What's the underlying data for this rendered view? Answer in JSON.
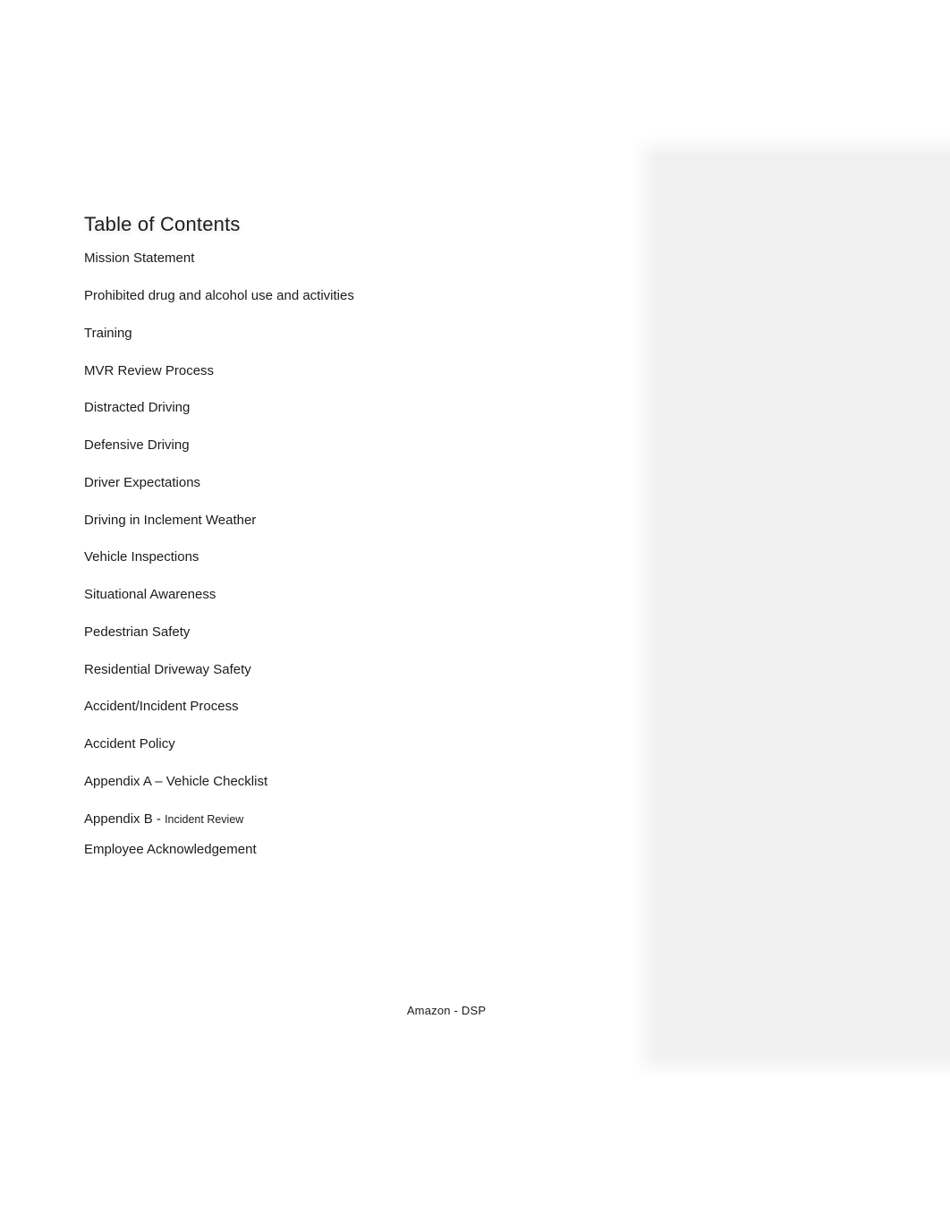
{
  "document": {
    "heading": "Table of Contents",
    "footer_text": "Amazon - DSP",
    "contents": [
      {
        "label": "Mission Statement"
      },
      {
        "label": "Prohibited drug and alcohol use and activities"
      },
      {
        "label": "Training"
      },
      {
        "label": "MVR Review Process"
      },
      {
        "label": "Distracted Driving"
      },
      {
        "label": "Defensive Driving"
      },
      {
        "label": "Driver Expectations"
      },
      {
        "label": "Driving in Inclement Weather"
      },
      {
        "label": "Vehicle Inspections"
      },
      {
        "label": "Situational Awareness"
      },
      {
        "label": "Pedestrian Safety"
      },
      {
        "label": "Residential Driveway Safety"
      },
      {
        "label": "Accident/Incident Process"
      },
      {
        "label": "Accident Policy"
      },
      {
        "label": "Appendix A – Vehicle Checklist"
      },
      {
        "label": "Appendix B - ",
        "sub_label": "Incident Review"
      },
      {
        "label": "Employee Acknowledgement"
      }
    ]
  },
  "colors": {
    "page_background": "#ffffff",
    "text": "#1b1b1b",
    "heading_text": "#1d1d1d",
    "panel_fill": "#f0f0f0"
  }
}
